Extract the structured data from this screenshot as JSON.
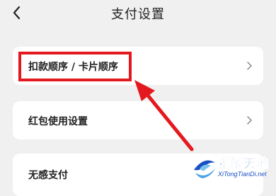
{
  "header": {
    "title": "支付设置",
    "back_icon": "chevron-left-icon"
  },
  "settings": [
    {
      "label": "扣款顺序 / 卡片顺序",
      "icon": "chevron-right-icon"
    },
    {
      "label": "红包使用设置",
      "icon": "chevron-right-icon"
    },
    {
      "label": "无感支付"
    }
  ],
  "annotation": {
    "highlight_color": "#e4191f"
  },
  "watermark": {
    "name_cn": "系统天地",
    "domain": "XiTongTianDi.net"
  }
}
